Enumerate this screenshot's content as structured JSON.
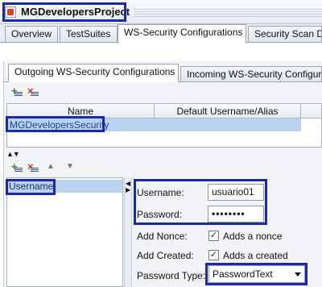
{
  "window": {
    "title": "MGDevelopersProject"
  },
  "main_tabs": [
    {
      "label": "Overview"
    },
    {
      "label": "TestSuites"
    },
    {
      "label": "WS-Security Configurations"
    },
    {
      "label": "Security Scan De"
    }
  ],
  "sub_tabs": [
    {
      "label": "Outgoing WS-Security Configurations"
    },
    {
      "label": "Incoming WS-Security Configura"
    }
  ],
  "config_table": {
    "columns": [
      "Name",
      "Default Username/Alias"
    ],
    "rows": [
      {
        "name": "MGDevelopersSecurity",
        "default_username": ""
      }
    ]
  },
  "entries": [
    {
      "label": "Username"
    }
  ],
  "form": {
    "username_label": "Username:",
    "username_value": "usuario01",
    "password_label": "Password:",
    "password_value": "••••••••",
    "add_nonce_label": "Add Nonce:",
    "add_nonce_text": "Adds a nonce",
    "add_nonce_checked": true,
    "add_created_label": "Add Created:",
    "add_created_text": "Adds a created",
    "add_created_checked": true,
    "password_type_label": "Password Type:",
    "password_type_value": "PasswordText"
  },
  "icons": [
    "project-icon",
    "add-icon",
    "remove-icon",
    "move-up-icon",
    "move-down-icon",
    "splitter-arrows-icon",
    "dropdown-arrow-icon",
    "check-icon"
  ],
  "colors": {
    "highlight": "#1c28a8",
    "selection": "#b9d3f0"
  }
}
